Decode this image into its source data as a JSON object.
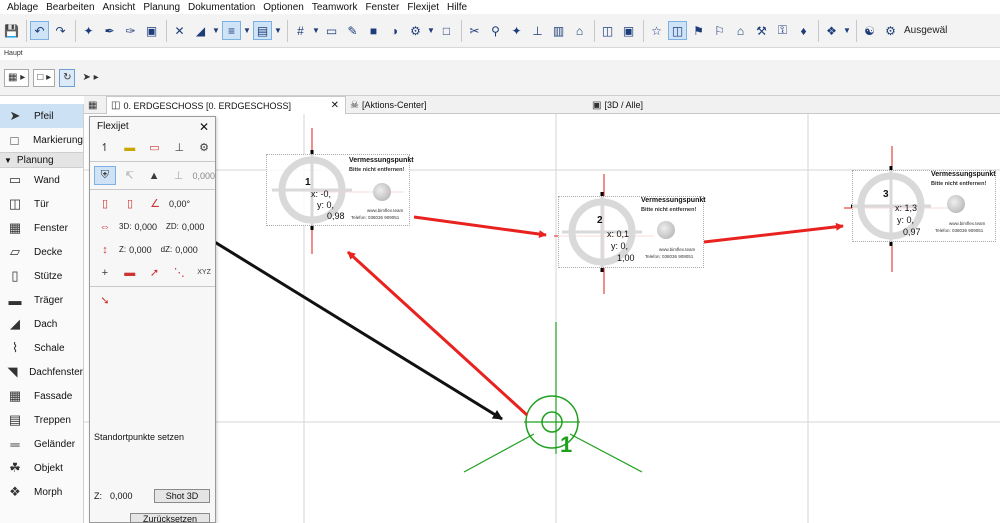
{
  "menu": [
    "Ablage",
    "Bearbeiten",
    "Ansicht",
    "Planung",
    "Dokumentation",
    "Optionen",
    "Teamwork",
    "Fenster",
    "Flexijet",
    "Hilfe"
  ],
  "toolbar": {
    "selection_label": "Ausgewäl"
  },
  "subtoolbar": {
    "label": "Haupt"
  },
  "tabs": [
    {
      "label": "0. ERDGESCHOSS [0. ERDGESCHOSS]",
      "active": true
    },
    {
      "label": "[Aktions-Center]",
      "active": false
    },
    {
      "label": "[3D / Alle]",
      "active": false
    }
  ],
  "palette": {
    "top_items": [
      {
        "label": "Pfeil",
        "icon": "pointer-icon",
        "selected": true
      },
      {
        "label": "Markierung",
        "icon": "marquee-icon",
        "selected": false
      }
    ],
    "group": "Planung",
    "items": [
      {
        "label": "Wand",
        "icon": "wall-icon"
      },
      {
        "label": "Tür",
        "icon": "door-icon"
      },
      {
        "label": "Fenster",
        "icon": "window-icon"
      },
      {
        "label": "Decke",
        "icon": "slab-icon"
      },
      {
        "label": "Stütze",
        "icon": "column-icon"
      },
      {
        "label": "Träger",
        "icon": "beam-icon"
      },
      {
        "label": "Dach",
        "icon": "roof-icon"
      },
      {
        "label": "Schale",
        "icon": "shell-icon"
      },
      {
        "label": "Dachfenster",
        "icon": "skylight-icon"
      },
      {
        "label": "Fassade",
        "icon": "curtain-wall-icon"
      },
      {
        "label": "Treppen",
        "icon": "stair-icon"
      },
      {
        "label": "Geländer",
        "icon": "railing-icon"
      },
      {
        "label": "Objekt",
        "icon": "object-icon"
      },
      {
        "label": "Morph",
        "icon": "morph-icon"
      }
    ]
  },
  "flexijet": {
    "title": "Flexijet",
    "value_1": "0,000",
    "angle": "0,00°",
    "three_d_label": "3D:",
    "three_d_value": "0,000",
    "z_label_row": "Z:",
    "z_value_row": "0,000",
    "xy_label": "XYZ",
    "status": "Standortpunkte setzen",
    "z_label": "Z:",
    "z_value": "0,000",
    "shot_button": "Shot 3D",
    "reset_button": "Zurücksetzen"
  },
  "survey_points": [
    {
      "num": "1",
      "title": "Vermessungspunkt",
      "subtitle": "Bitte nicht entfernen!",
      "x": "x: -0,",
      "y": "y: 0,",
      "z": "0,98",
      "website": "www.bimflex.team",
      "phone": "Telefon: 038036 909051"
    },
    {
      "num": "2",
      "title": "Vermessungspunkt",
      "subtitle": "Bitte nicht entfernen!",
      "x": "x: 0,1",
      "y": "y: 0,",
      "z": "1,00",
      "website": "www.bimflex.team",
      "phone": "Telefon: 038036 909051"
    },
    {
      "num": "3",
      "title": "Vermessungspunkt",
      "subtitle": "Bitte nicht entfernen!",
      "x": "x: 1,3",
      "y": "y: 0,",
      "z": "0,97",
      "website": "www.bimflex.team",
      "phone": "Telefon: 038036 909051"
    }
  ],
  "station_label": "1",
  "colors": {
    "selection": "#cfe3f7",
    "arrow_red": "#e8231f",
    "arrow_black": "#111111",
    "station_green": "#1ea01e",
    "crosshair_red": "#e11d1d"
  }
}
